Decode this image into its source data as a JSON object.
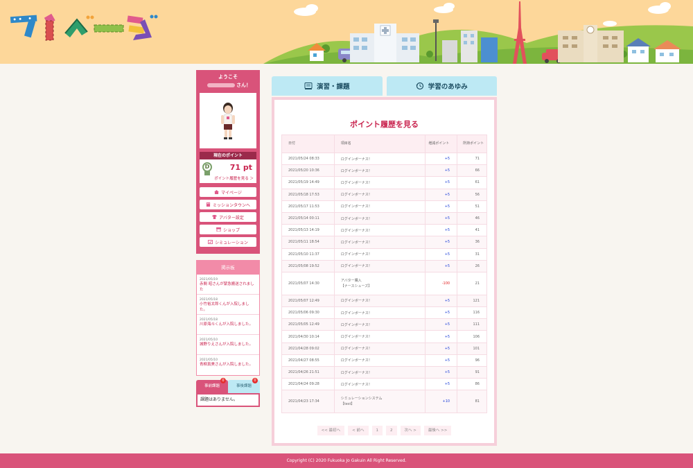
{
  "header": {
    "logo_text": "マイページ"
  },
  "sidebar": {
    "welcome": "ようこそ",
    "name_suffix": "さん！",
    "points_label": "現在のポイント",
    "rank": "D",
    "points": "71 pt",
    "points_link": "ポイント履歴を見る ＞",
    "menu": [
      {
        "label": "マイページ",
        "icon": "home-icon"
      },
      {
        "label": "ミッションタウンへ",
        "icon": "building-icon"
      },
      {
        "label": "アバター設定",
        "icon": "shirt-icon"
      },
      {
        "label": "ショップ",
        "icon": "shop-icon"
      },
      {
        "label": "シミュレーション",
        "icon": "simulation-icon"
      }
    ],
    "board": {
      "title": "掲示板",
      "items": [
        {
          "date": "2021/05/19",
          "text": "赤間 昭さんが緊急搬送されました"
        },
        {
          "date": "2021/05/18",
          "text": "小竹裕太郎くんが入院しました。"
        },
        {
          "date": "2021/05/18",
          "text": "川原海斗くんが入院しました。"
        },
        {
          "date": "2021/05/10",
          "text": "城野りえさんが入院しました。"
        },
        {
          "date": "2021/05/10",
          "text": "青柳真美さんが入院しました。"
        }
      ]
    },
    "tasks": {
      "tab1": "事前課題",
      "tab1_badge": "0",
      "tab2": "事後課題",
      "tab2_badge": "0",
      "empty": "課題はありません。"
    }
  },
  "tabs": [
    {
      "label": "演習・課題",
      "icon": "book-icon"
    },
    {
      "label": "学習のあゆみ",
      "icon": "history-icon"
    }
  ],
  "main": {
    "title": "ポイント履歴を見る",
    "columns": {
      "date": "日付",
      "item": "項目名",
      "change": "増減ポイント",
      "held": "所持ポイント"
    },
    "rows": [
      {
        "date": "2021/05/24 08:33",
        "item": "ログインボーナス！",
        "change": "+5",
        "held": "71"
      },
      {
        "date": "2021/05/20 10:36",
        "item": "ログインボーナス！",
        "change": "+5",
        "held": "66"
      },
      {
        "date": "2021/05/19 14:49",
        "item": "ログインボーナス！",
        "change": "+5",
        "held": "61"
      },
      {
        "date": "2021/05/18 17:53",
        "item": "ログインボーナス！",
        "change": "+5",
        "held": "56"
      },
      {
        "date": "2021/05/17 11:53",
        "item": "ログインボーナス！",
        "change": "+5",
        "held": "51"
      },
      {
        "date": "2021/05/14 00:11",
        "item": "ログインボーナス！",
        "change": "+5",
        "held": "46"
      },
      {
        "date": "2021/05/13 14:19",
        "item": "ログインボーナス！",
        "change": "+5",
        "held": "41"
      },
      {
        "date": "2021/05/11 18:54",
        "item": "ログインボーナス！",
        "change": "+5",
        "held": "36"
      },
      {
        "date": "2021/05/10 11:37",
        "item": "ログインボーナス！",
        "change": "+5",
        "held": "31"
      },
      {
        "date": "2021/05/08 19:52",
        "item": "ログインボーナス！",
        "change": "+5",
        "held": "26"
      },
      {
        "date": "2021/05/07 14:30",
        "item": "アバター購入",
        "item2": "【ナースシューズ】",
        "change": "-100",
        "held": "21"
      },
      {
        "date": "2021/05/07 12:49",
        "item": "ログインボーナス！",
        "change": "+5",
        "held": "121"
      },
      {
        "date": "2021/05/06 09:30",
        "item": "ログインボーナス！",
        "change": "+5",
        "held": "116"
      },
      {
        "date": "2021/05/05 12:49",
        "item": "ログインボーナス！",
        "change": "+5",
        "held": "111"
      },
      {
        "date": "2021/04/30 10:14",
        "item": "ログインボーナス！",
        "change": "+5",
        "held": "106"
      },
      {
        "date": "2021/04/28 09:02",
        "item": "ログインボーナス！",
        "change": "+5",
        "held": "101"
      },
      {
        "date": "2021/04/27 08:55",
        "item": "ログインボーナス！",
        "change": "+5",
        "held": "96"
      },
      {
        "date": "2021/04/26 21:51",
        "item": "ログインボーナス！",
        "change": "+5",
        "held": "91"
      },
      {
        "date": "2021/04/24 09:28",
        "item": "ログインボーナス！",
        "change": "+5",
        "held": "86"
      },
      {
        "date": "2021/04/23 17:34",
        "item": "シミュレーションシステム",
        "item2": "【test】",
        "change": "+10",
        "held": "81"
      }
    ],
    "pager": [
      "<< 最初へ",
      "< 前へ",
      "1",
      "2",
      "次へ >",
      "最後へ >>"
    ]
  },
  "footer": {
    "copyright": "Copyright (C) 2020 Fukuoka Jo Gakuin All Right Reserved."
  },
  "colors": {
    "accent": "#d9537a",
    "tab": "#bde9f4",
    "positive": "#1d3fd8",
    "negative": "#e02020"
  }
}
